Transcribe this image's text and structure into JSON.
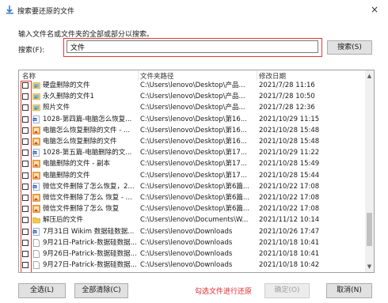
{
  "window": {
    "title": "搜索要还原的文件",
    "close": "×"
  },
  "instruction": "输入文件名或文件夹的全部或部分以搜索。",
  "search": {
    "label": "搜索(F):",
    "value": "文件",
    "button": "搜索(S)"
  },
  "columns": {
    "name": "名称",
    "path": "文件夹路径",
    "date": "修改日期"
  },
  "rows": [
    {
      "name": "硬盘删除的文件",
      "path": "C:\\Users\\lenovo\\Desktop\\产品...",
      "date": "2021/7/28 11:16",
      "icon": "folder-image-icon"
    },
    {
      "name": "永久删除的文件1",
      "path": "C:\\Users\\lenovo\\Desktop\\产品...",
      "date": "2021/7/28 10:50",
      "icon": "folder-image-icon"
    },
    {
      "name": "照片文件",
      "path": "C:\\Users\\lenovo\\Desktop\\产品...",
      "date": "2021/7/28 12:36",
      "icon": "folder-image-icon"
    },
    {
      "name": "1028-第四篇-电脑怎么恢复...",
      "path": "C:\\Users\\lenovo\\Desktop\\第16...",
      "date": "2021/10/29 11:15",
      "icon": "word-doc-icon"
    },
    {
      "name": "电脑怎么恢复删除的文件 - ...",
      "path": "C:\\Users\\lenovo\\Desktop\\第16...",
      "date": "2021/10/28 15:48",
      "icon": "image-file-icon"
    },
    {
      "name": "电脑怎么恢复删除的文件",
      "path": "C:\\Users\\lenovo\\Desktop\\第16...",
      "date": "2021/10/28 15:48",
      "icon": "image-file-icon"
    },
    {
      "name": "1028-第五篇-电脑删除的文...",
      "path": "C:\\Users\\lenovo\\Desktop\\第17...",
      "date": "2021/10/29 11:22",
      "icon": "word-doc-icon"
    },
    {
      "name": "电脑删除的文件 - 副本",
      "path": "C:\\Users\\lenovo\\Desktop\\第17...",
      "date": "2021/10/28 15:49",
      "icon": "image-file-icon"
    },
    {
      "name": "电脑删除的文件",
      "path": "C:\\Users\\lenovo\\Desktop\\第17...",
      "date": "2021/10/28 15:44",
      "icon": "image-file-icon"
    },
    {
      "name": "微信文件删除了怎么恢复，2...",
      "path": "C:\\Users\\lenovo\\Desktop\\第6篇...",
      "date": "2021/10/22 17:08",
      "icon": "word-doc-icon"
    },
    {
      "name": "微信文件删除了怎么 恢复 - ...",
      "path": "C:\\Users\\lenovo\\Desktop\\第6篇...",
      "date": "2021/10/22 17:08",
      "icon": "image-file-icon"
    },
    {
      "name": "微信文件删除了怎么 恢复",
      "path": "C:\\Users\\lenovo\\Desktop\\第6篇...",
      "date": "2021/10/22 17:08",
      "icon": "image-file-icon"
    },
    {
      "name": "解压后的文件",
      "path": "C:\\Users\\lenovo\\Documents\\W...",
      "date": "2021/11/12 10:14",
      "icon": "folder-icon"
    },
    {
      "name": "7月31日 Wikim 数据硅数据...",
      "path": "C:\\Users\\lenovo\\Downloads",
      "date": "2021/10/26 17:47",
      "icon": "word-doc-icon"
    },
    {
      "name": "9月21日-Patrick-数据硅数据...",
      "path": "C:\\Users\\lenovo\\Downloads",
      "date": "2021/10/18 10:41",
      "icon": "blank-file-icon"
    },
    {
      "name": "9月26日-Patrick-数据硅数据...",
      "path": "C:\\Users\\lenovo\\Downloads",
      "date": "2021/10/18 10:41",
      "icon": "blank-file-icon"
    },
    {
      "name": "9月27日-Patrick-数据硅数据...",
      "path": "C:\\Users\\lenovo\\Downloads",
      "date": "2021/10/18 10:42",
      "icon": "blank-file-icon"
    }
  ],
  "footer": {
    "select_all": "全选(L)",
    "clear_all": "全部清除(C)",
    "hint": "勾选文件进行还原",
    "ok": "确定(O)",
    "cancel": "取消(N)"
  },
  "colors": {
    "highlight": "#e03a3a",
    "hint_text": "#e0282a"
  }
}
